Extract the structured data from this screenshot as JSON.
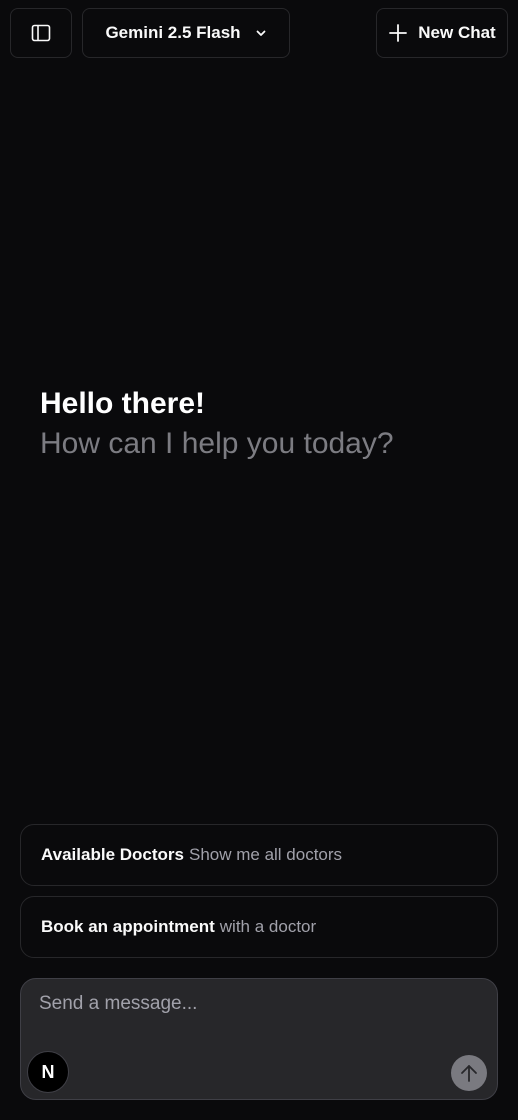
{
  "header": {
    "sidebar_toggle_icon": "sidebar-panel-icon",
    "model_label": "Gemini 2.5 Flash",
    "model_chevron_icon": "chevron-down-icon",
    "new_chat_label": "New Chat",
    "new_chat_icon": "plus-icon"
  },
  "greeting": {
    "title": "Hello there!",
    "subtitle": "How can I help you today?"
  },
  "suggestions": [
    {
      "title": "Available Doctors",
      "subtitle": "Show me all doctors"
    },
    {
      "title": "Book an appointment",
      "subtitle": "with a doctor"
    }
  ],
  "composer": {
    "placeholder": "Send a message...",
    "logo_letter": "N",
    "send_icon": "arrow-up-icon"
  },
  "colors": {
    "background": "#0a0a0c",
    "border": "#27272a",
    "composer_bg": "#27272a",
    "muted_text": "#a1a1aa",
    "send_button": "#7a7a80"
  }
}
